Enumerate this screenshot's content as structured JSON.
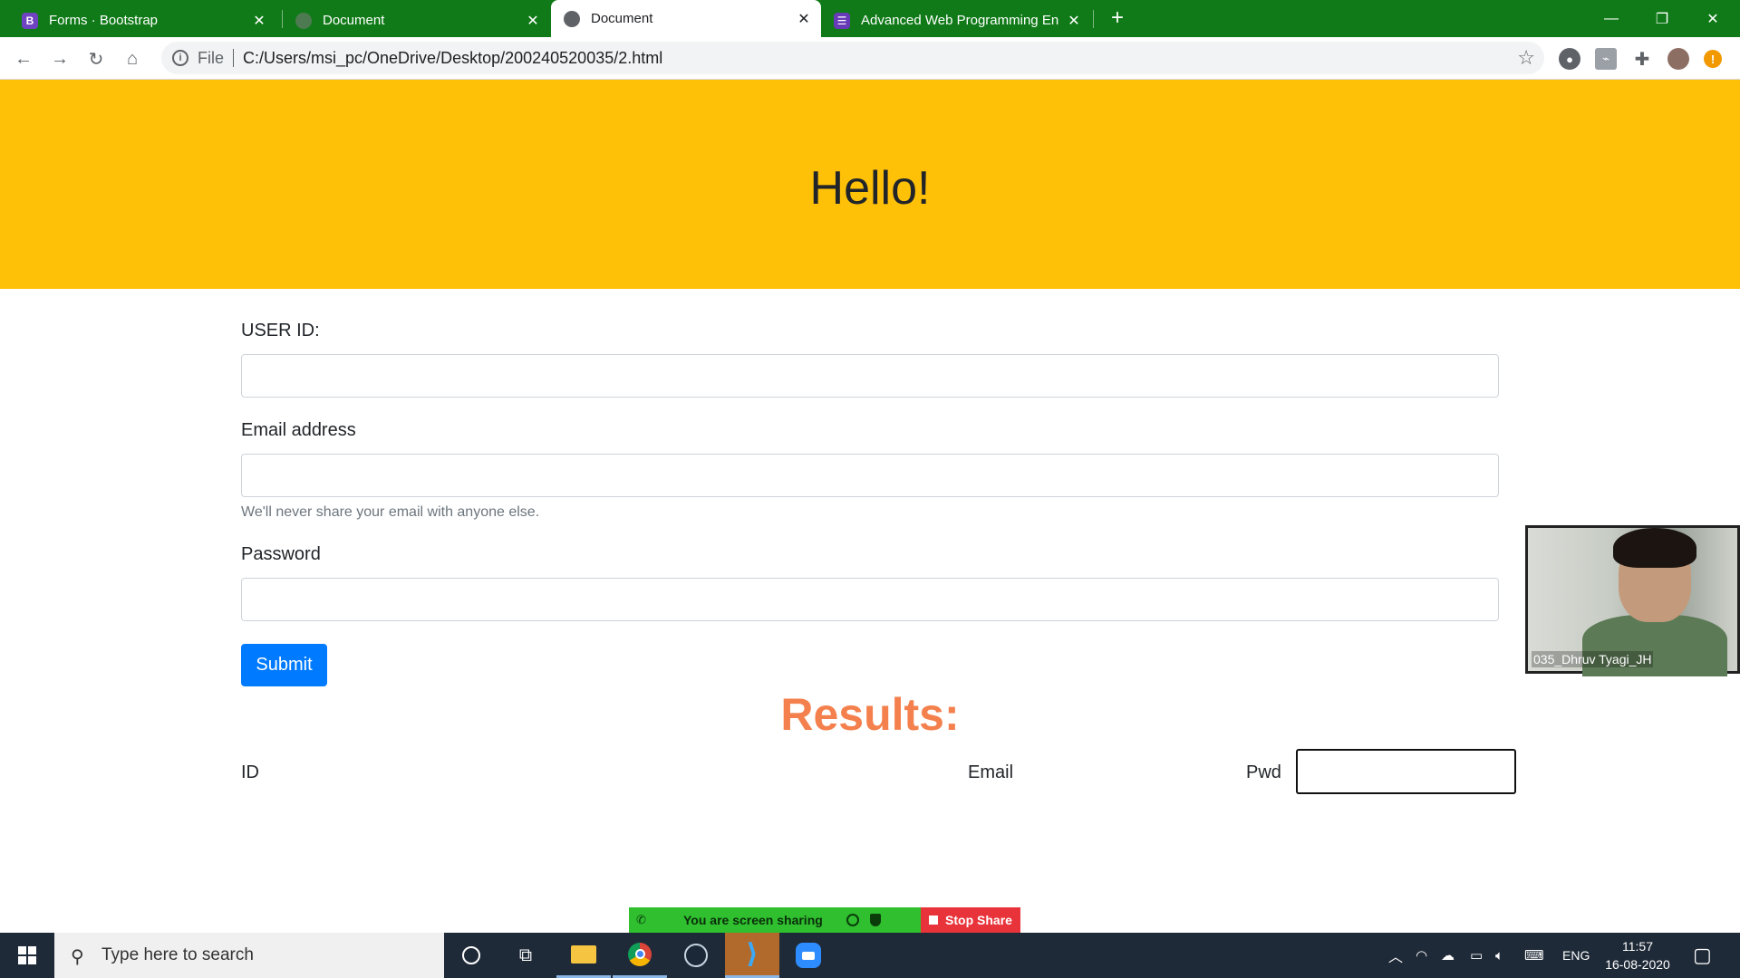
{
  "browser": {
    "tabs": [
      {
        "title": "Forms · Bootstrap",
        "favicon": "bootstrap-icon",
        "active": false
      },
      {
        "title": "Document",
        "favicon": "globe-icon",
        "active": false
      },
      {
        "title": "Document",
        "favicon": "globe-icon",
        "active": true
      },
      {
        "title": "Advanced Web Programming En",
        "favicon": "forms-icon",
        "active": false
      }
    ],
    "address": {
      "scheme": "File",
      "url": "C:/Users/msi_pc/OneDrive/Desktop/200240520035/2.html"
    }
  },
  "page": {
    "heading": "Hello!",
    "form": {
      "userid_label": "USER ID:",
      "email_label": "Email address",
      "email_help": "We'll never share your email with anyone else.",
      "password_label": "Password",
      "submit_label": "Submit"
    },
    "results": {
      "title": "Results:",
      "id_label": "ID",
      "email_label": "Email",
      "pwd_label": "Pwd"
    }
  },
  "video": {
    "participant": "035_Dhruv Tyagi_JH"
  },
  "screenshare": {
    "status": "You are screen sharing",
    "stop_label": "Stop Share"
  },
  "taskbar": {
    "search_placeholder": "Type here to search",
    "language": "ENG",
    "time": "11:57",
    "date": "16-08-2020"
  },
  "colors": {
    "tabbar": "#0f7a17",
    "jumbotron": "#ffc107",
    "primary": "#007bff",
    "results_title": "#f4804d",
    "share_green": "#2fbf2f",
    "stop_red": "#e8333a",
    "taskbar": "#1f2a38"
  }
}
